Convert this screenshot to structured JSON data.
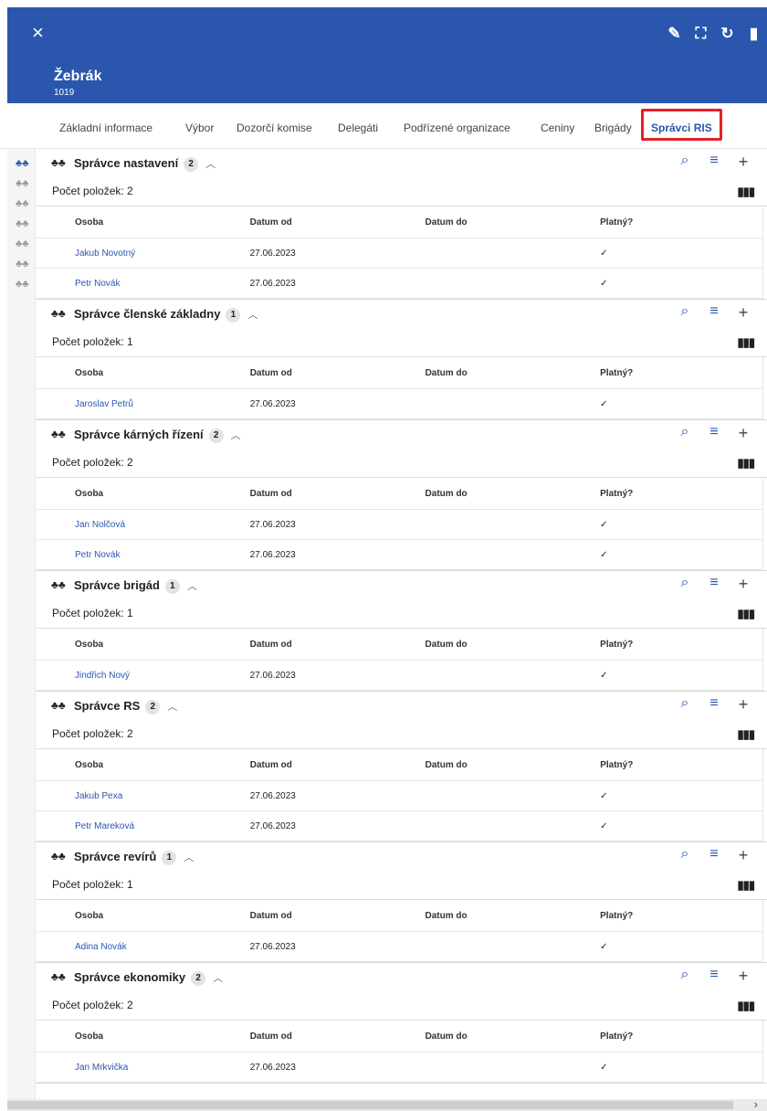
{
  "header": {
    "title": "Žebrák",
    "subtitle": "1019",
    "close_icon": "×",
    "tools": [
      {
        "name": "edit-icon",
        "glyph": "✎"
      },
      {
        "name": "fullscreen-icon",
        "glyph": "⛶"
      },
      {
        "name": "refresh-icon",
        "glyph": "↻"
      },
      {
        "name": "delete-icon",
        "glyph": "▮"
      }
    ]
  },
  "tabs": [
    {
      "label": "Základní informace"
    },
    {
      "label": "Výbor"
    },
    {
      "label": "Dozorčí komise"
    },
    {
      "label": "Delegáti"
    },
    {
      "label": "Podřízené organizace"
    },
    {
      "label": "Ceniny"
    },
    {
      "label": "Brigády"
    },
    {
      "label": "Správci RIS",
      "active": true
    }
  ],
  "columns": {
    "person": "Osoba",
    "date_from": "Datum od",
    "date_to": "Datum do",
    "valid": "Platný?"
  },
  "sections": [
    {
      "title": "Správce nastavení",
      "badge": "2",
      "count": "Počet položek: 2",
      "rows": [
        {
          "person": "Jakub Novotný",
          "date_from": "27.06.2023",
          "date_to": "",
          "valid": "✓"
        },
        {
          "person": "Petr Novák",
          "date_from": "27.06.2023",
          "date_to": "",
          "valid": "✓"
        }
      ]
    },
    {
      "title": "Správce členské základny",
      "badge": "1",
      "count": "Počet položek: 1",
      "rows": [
        {
          "person": "Jaroslav Petrů",
          "date_from": "27.06.2023",
          "date_to": "",
          "valid": "✓"
        }
      ]
    },
    {
      "title": "Správce kárných řízení",
      "badge": "2",
      "count": "Počet položek: 2",
      "rows": [
        {
          "person": "Jan Nolčová",
          "date_from": "27.06.2023",
          "date_to": "",
          "valid": "✓"
        },
        {
          "person": "Petr Novák",
          "date_from": "27.06.2023",
          "date_to": "",
          "valid": "✓"
        }
      ]
    },
    {
      "title": "Správce brigád",
      "badge": "1",
      "count": "Počet položek: 1",
      "rows": [
        {
          "person": "Jindřich Nový",
          "date_from": "27.06.2023",
          "date_to": "",
          "valid": "✓"
        }
      ]
    },
    {
      "title": "Správce RS",
      "badge": "2",
      "count": "Počet položek: 2",
      "rows": [
        {
          "person": "Jakub Pexa",
          "date_from": "27.06.2023",
          "date_to": "",
          "valid": "✓"
        },
        {
          "person": "Petr Mareková",
          "date_from": "27.06.2023",
          "date_to": "",
          "valid": "✓"
        }
      ]
    },
    {
      "title": "Správce revírů",
      "badge": "1",
      "count": "Počet položek: 1",
      "rows": [
        {
          "person": "Adina Novák",
          "date_from": "27.06.2023",
          "date_to": "",
          "valid": "✓"
        }
      ]
    },
    {
      "title": "Správce ekonomiky",
      "badge": "2",
      "count": "Počet položek: 2",
      "rows": [
        {
          "person": "Jan Mrkvička",
          "date_from": "27.06.2023",
          "date_to": "",
          "valid": "✓"
        }
      ]
    }
  ],
  "colors": {
    "primary": "#2a57ad",
    "highlight": "#e52026"
  }
}
